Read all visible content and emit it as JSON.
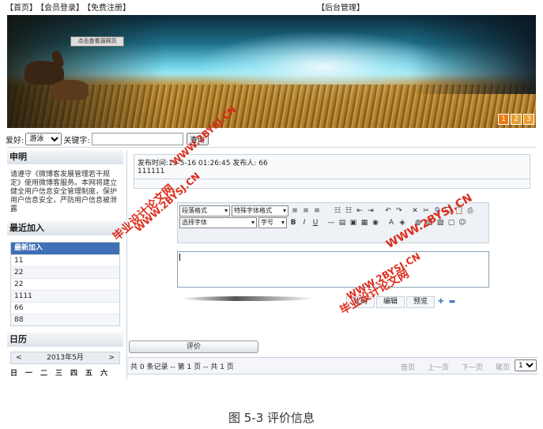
{
  "topnav": {
    "home": "【首页】",
    "login": "【会员登录】",
    "register": "【免费注册】",
    "admin": "【后台管理】"
  },
  "banner": {
    "button": "点击查看源网页",
    "pages": [
      "1",
      "2",
      "3"
    ]
  },
  "search": {
    "hobby_label": "爱好:",
    "hobby_value": "游泳",
    "keyword_label": "关键字:",
    "keyword_value": "",
    "submit": "查询"
  },
  "sidebar": {
    "notice_title": "申明",
    "notice_text": "请遵守《微博客发展管理若干规定》使用微博客服务。本网将建立健全用户信息安全管理制度，保护用户信息安全，严防用户信息被泄露",
    "recent_title": "最近加入",
    "recent_header": "最新加入",
    "recent_items": [
      "11",
      "22",
      "22",
      "1111",
      "66",
      "88"
    ],
    "calendar_title": "日历",
    "calendar_prev": "<",
    "calendar_month": "2013年5月",
    "calendar_next": ">",
    "calendar_week": "日一二三四五六"
  },
  "post": {
    "time_label": "发布时间:",
    "time_value": "13-5-16 01:26:45",
    "author_label": "发布人:",
    "author_value": "66",
    "content": "111111"
  },
  "toolbar": {
    "para_format": "段落格式",
    "special_font": "特殊字体格式",
    "select_font": "选择字体",
    "font_size": "字号"
  },
  "editor_tabs": {
    "code": "代码",
    "edit": "编辑",
    "preview": "预览"
  },
  "comment_button": "评价",
  "pagination": {
    "info": "共 0 条记录 -- 第 1 页 -- 共 1 页",
    "first": "首页",
    "prev": "上一页",
    "next": "下一页",
    "last": "尾页",
    "page_select": "1"
  },
  "watermarks": [
    "毕业设计论文网",
    "WWW.2BYSJ.CN"
  ],
  "caption": "图 5-3 评价信息"
}
